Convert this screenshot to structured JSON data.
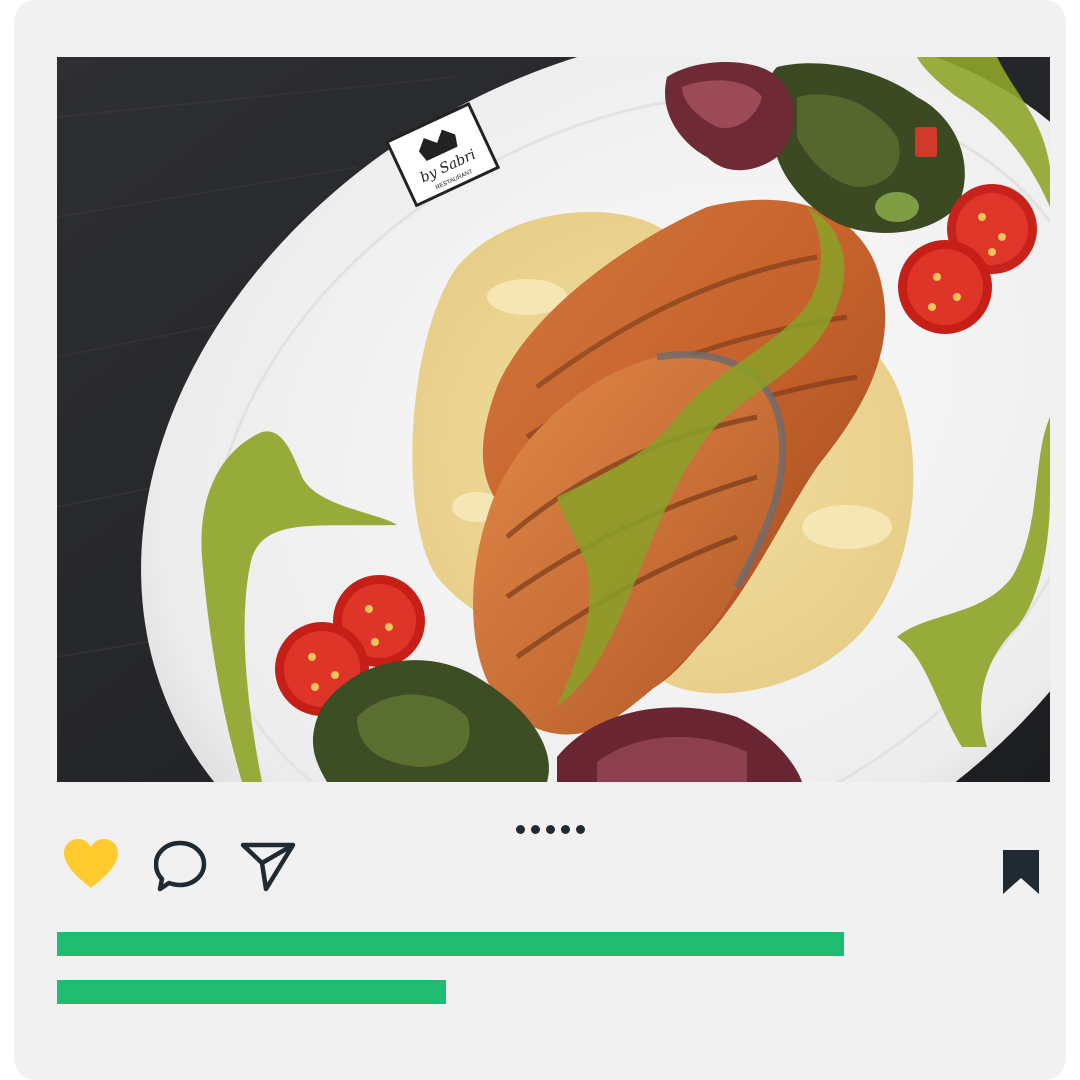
{
  "post": {
    "image": {
      "subject": "photo",
      "logo_text_primary": "by Sabri",
      "logo_text_secondary": "RESTAURANT"
    },
    "carousel": {
      "count": 5,
      "active_index": 0
    },
    "actions": {
      "like_icon": "heart-icon",
      "comment_icon": "comment-bubble-icon",
      "share_icon": "send-paper-plane-icon",
      "save_icon": "bookmark-icon"
    },
    "caption_placeholders": [
      {
        "fraction": 0.87
      },
      {
        "fraction": 0.43
      }
    ]
  },
  "colors": {
    "card_bg": "#f1f1f1",
    "like": "#ffcb2f",
    "icons": "#1f2a33",
    "caption_bar": "#1fbc71"
  }
}
